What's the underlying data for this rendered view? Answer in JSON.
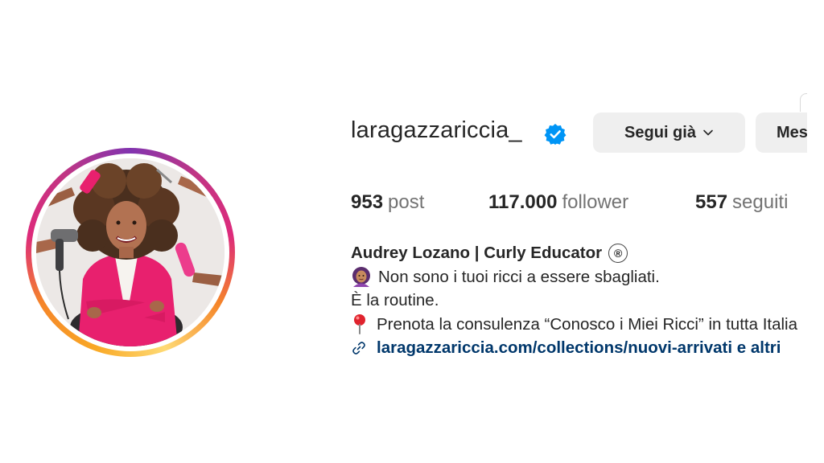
{
  "profile": {
    "username": "laragazzariccia_",
    "verified": true
  },
  "actions": {
    "follow_label": "Segui già",
    "message_label": "Messaggio"
  },
  "stats": {
    "posts": {
      "value": "953",
      "label": "post"
    },
    "followers": {
      "value": "117.000",
      "label": "follower"
    },
    "following": {
      "value": "557",
      "label": "seguiti"
    }
  },
  "bio": {
    "name": "Audrey Lozano | Curly Educator",
    "registered_mark": "®",
    "line1": "Non sono i tuoi ricci a essere sbagliati.",
    "line2": "È la routine.",
    "line3": "Prenota la consulenza “Conosco i Miei Ricci” in tutta Italia",
    "link": "laragazzariccia.com/collections/nuovi-arrivati e altri"
  },
  "colors": {
    "accent_verified": "#0095f6",
    "link": "#00376b",
    "button_bg": "#efefef",
    "muted_text": "#737373"
  },
  "icons": [
    "verified-badge-icon",
    "chevron-down-icon",
    "woman-curly-hair-emoji-icon",
    "round-pushpin-icon",
    "link-icon"
  ]
}
